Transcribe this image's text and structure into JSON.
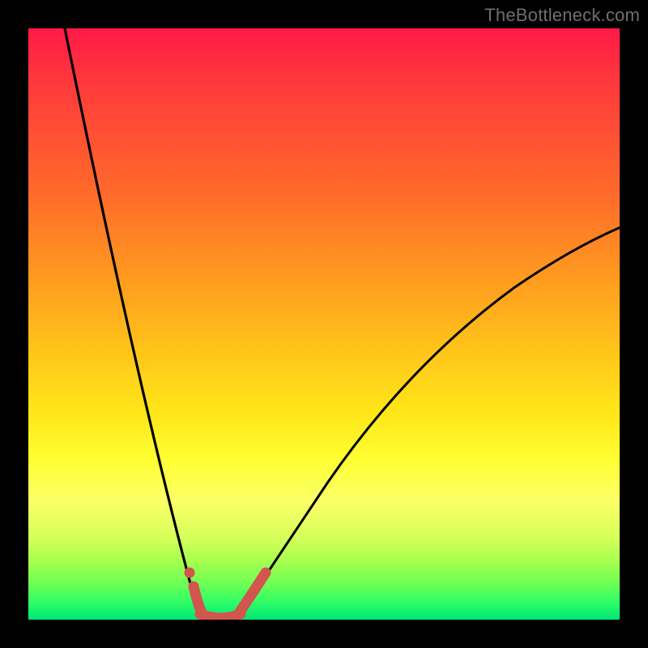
{
  "watermark": {
    "text": "TheBottleneck.com"
  },
  "colors": {
    "page_bg": "#000000",
    "gradient": [
      "#ff1a47",
      "#ff3b3b",
      "#ff6a2a",
      "#ff9a1f",
      "#ffc61a",
      "#ffe619",
      "#ffff33",
      "#fbff66",
      "#d6ff5a",
      "#a9ff4f",
      "#6dff55",
      "#2fff66",
      "#00e676"
    ],
    "curve_stroke": "#000000",
    "marker_stroke": "#d2554e",
    "marker_fill": "#d2554e"
  },
  "chart_data": {
    "type": "line",
    "x": [
      0.0,
      0.05,
      0.1,
      0.15,
      0.2,
      0.25,
      0.275,
      0.3,
      0.325,
      0.35,
      0.4,
      0.45,
      0.5,
      0.55,
      0.6,
      0.65,
      0.7,
      0.75,
      0.8,
      0.85,
      0.9,
      0.95,
      1.0
    ],
    "series": [
      {
        "name": "bottleneck-curve",
        "values": [
          1.0,
          0.82,
          0.64,
          0.46,
          0.27,
          0.09,
          0.02,
          0.0,
          0.0,
          0.02,
          0.08,
          0.15,
          0.22,
          0.28,
          0.34,
          0.39,
          0.44,
          0.48,
          0.52,
          0.56,
          0.59,
          0.62,
          0.65
        ]
      }
    ],
    "optimum_segment": {
      "x_start": 0.275,
      "x_end": 0.35,
      "y": 0.0
    },
    "optimum_dot": {
      "x": 0.265,
      "y": 0.028
    },
    "title": "",
    "xlabel": "",
    "ylabel": "",
    "xlim": [
      0,
      1
    ],
    "ylim": [
      0,
      1
    ],
    "note": "y is fraction of plot height from bottom; x is fraction of plot width. Values estimated from gradient and curve shape."
  }
}
